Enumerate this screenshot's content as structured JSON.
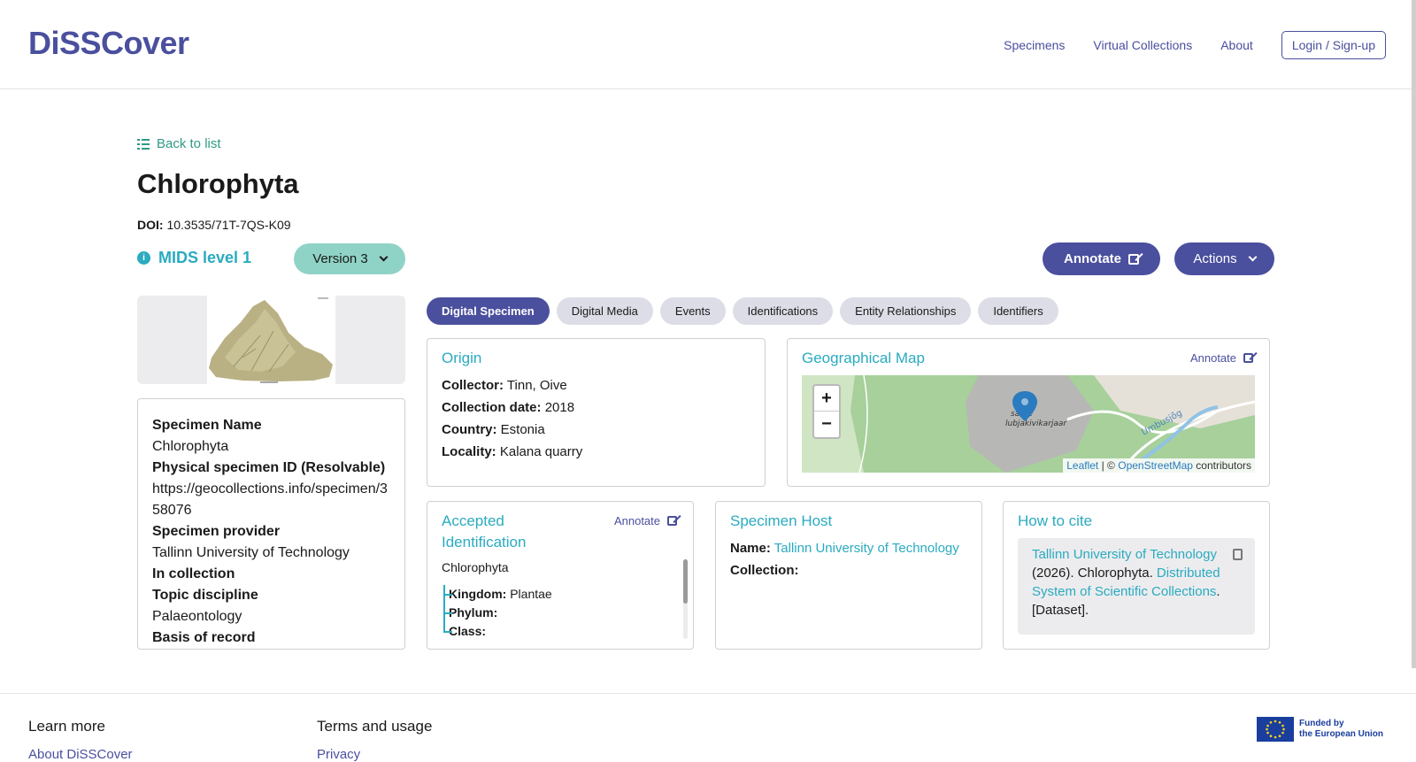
{
  "header": {
    "logo": "DiSSCover",
    "nav": [
      "Specimens",
      "Virtual Collections",
      "About"
    ],
    "login_label": "Login / Sign-up"
  },
  "page": {
    "back_label": "Back to list",
    "title": "Chlorophyta",
    "doi_label": "DOI:",
    "doi_value": "10.3535/71T-7QS-K09",
    "mids_label": "MIDS level 1",
    "version_label": "Version 3",
    "annotate_label": "Annotate",
    "actions_label": "Actions"
  },
  "specimen_info": {
    "fields": [
      {
        "label": "Specimen Name",
        "value": "Chlorophyta"
      },
      {
        "label": "Physical specimen ID (Resolvable)",
        "value": "https://geocollections.info/specimen/358076"
      },
      {
        "label": "Specimen provider",
        "value": "Tallinn University of Technology"
      },
      {
        "label": "In collection",
        "value": ""
      },
      {
        "label": "Topic discipline",
        "value": "Palaeontology"
      },
      {
        "label": "Basis of record",
        "value": ""
      }
    ]
  },
  "tabs": [
    "Digital Specimen",
    "Digital Media",
    "Events",
    "Identifications",
    "Entity Relationships",
    "Identifiers"
  ],
  "origin": {
    "title": "Origin",
    "rows": [
      {
        "label": "Collector:",
        "value": "Tinn, Oive"
      },
      {
        "label": "Collection date:",
        "value": "2018"
      },
      {
        "label": "Country:",
        "value": "Estonia"
      },
      {
        "label": "Locality:",
        "value": "Kalana quarry"
      }
    ]
  },
  "map": {
    "title": "Geographical Map",
    "annotate_label": "Annotate",
    "zoom_in": "+",
    "zoom_out": "−",
    "place_label_1": "saare",
    "place_label_2": "lubjakivikarjaar",
    "river_label": "Umbusjõg",
    "attribution_leaflet": "Leaflet",
    "attribution_sep": "| ©",
    "attribution_osm": "OpenStreetMap",
    "attribution_rest": "contributors"
  },
  "identification": {
    "title": "Accepted Identification",
    "annotate_label": "Annotate",
    "name": "Chlorophyta",
    "ranks": [
      {
        "label": "Kingdom:",
        "value": "Plantae"
      },
      {
        "label": "Phylum:",
        "value": ""
      },
      {
        "label": "Class:",
        "value": ""
      }
    ]
  },
  "host": {
    "title": "Specimen Host",
    "name_label": "Name:",
    "name_value": "Tallinn University of Technology",
    "collection_label": "Collection:"
  },
  "cite": {
    "title": "How to cite",
    "part1": "Tallinn University of Technology",
    "part2": "(2026). Chlorophyta.",
    "part3": "Distributed System of Scientific Collections",
    "part4": ". [Dataset]."
  },
  "footer": {
    "learn_more": "Learn more",
    "about_link": "About DiSSCover",
    "terms": "Terms and usage",
    "privacy": "Privacy",
    "eu_line1": "Funded by",
    "eu_line2": "the European Union"
  },
  "colors": {
    "brand": "#4a4f9e",
    "accent": "#2aabc0",
    "teal": "#2e9a86",
    "version_bg": "#8fd3c6"
  }
}
